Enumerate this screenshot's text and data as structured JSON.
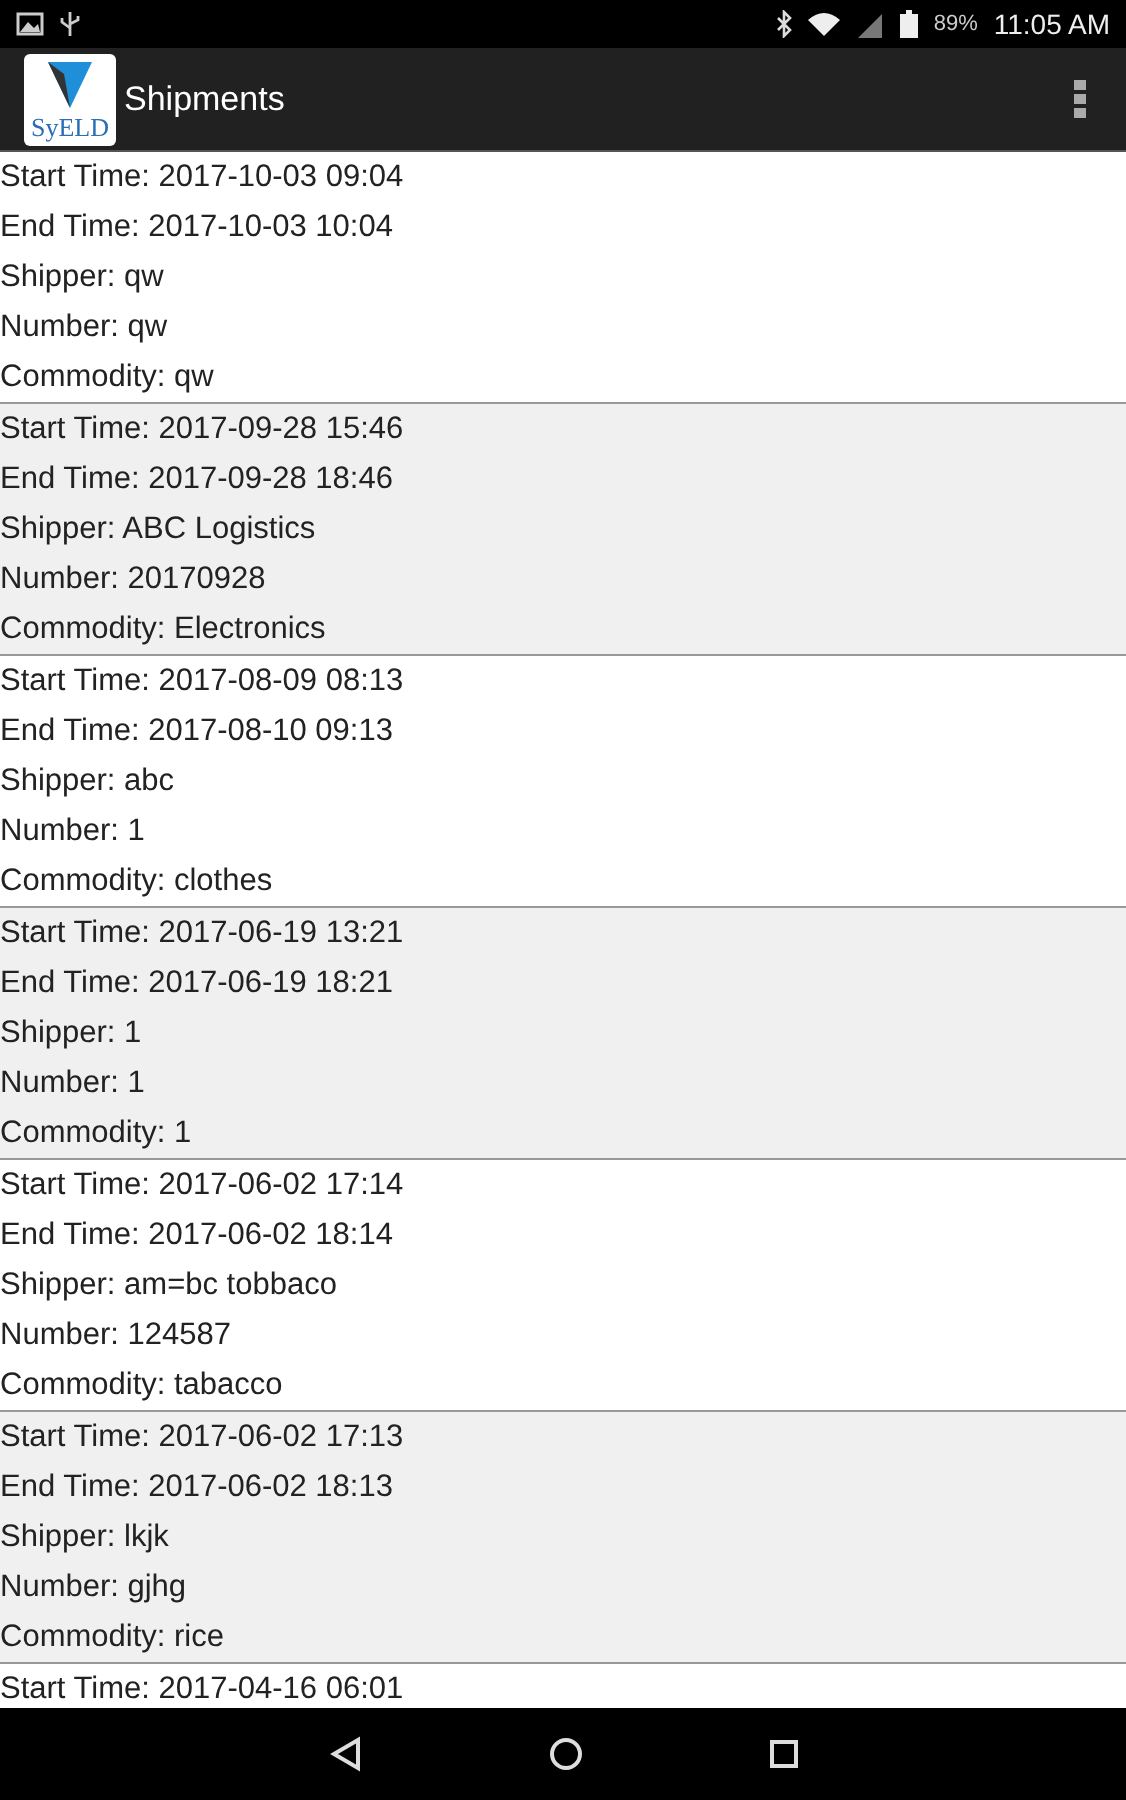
{
  "status_bar": {
    "battery": "89%",
    "time": "11:05 AM"
  },
  "app_bar": {
    "logo_text": "SyELD",
    "title": "Shipments"
  },
  "shipments": [
    {
      "shaded": false,
      "lines": [
        "Start Time: 2017-10-03 09:04",
        "End Time: 2017-10-03 10:04",
        "Shipper: qw",
        "Number: qw",
        "Commodity: qw"
      ]
    },
    {
      "shaded": true,
      "lines": [
        "Start Time: 2017-09-28 15:46",
        "End Time: 2017-09-28 18:46",
        "Shipper: ABC Logistics",
        "Number: 20170928",
        "Commodity: Electronics"
      ]
    },
    {
      "shaded": false,
      "lines": [
        "Start Time: 2017-08-09 08:13",
        "End Time: 2017-08-10 09:13",
        "Shipper: abc",
        "Number: 1",
        "Commodity: clothes"
      ]
    },
    {
      "shaded": true,
      "lines": [
        "Start Time: 2017-06-19 13:21",
        "End Time: 2017-06-19 18:21",
        "Shipper: 1",
        "Number: 1",
        "Commodity: 1"
      ]
    },
    {
      "shaded": false,
      "lines": [
        "Start Time: 2017-06-02 17:14",
        "End Time: 2017-06-02 18:14",
        "Shipper: am=bc tobbaco",
        "Number: 124587",
        "Commodity: tabacco"
      ]
    },
    {
      "shaded": true,
      "lines": [
        "Start Time: 2017-06-02 17:13",
        "End Time: 2017-06-02 18:13",
        "Shipper: lkjk",
        "Number: gjhg",
        "Commodity: rice"
      ]
    },
    {
      "shaded": false,
      "lines": [
        "Start Time: 2017-04-16 06:01"
      ]
    }
  ]
}
